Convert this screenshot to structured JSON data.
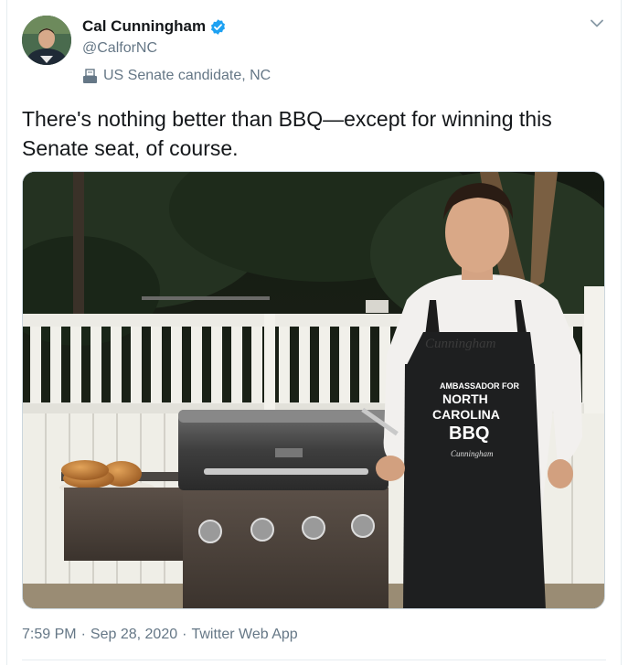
{
  "tweet": {
    "author": {
      "display_name": "Cal Cunningham",
      "handle": "@CalforNC",
      "verified": true,
      "label": "US Senate candidate, NC",
      "label_icon": "ballot-box-icon"
    },
    "text": "There's nothing better than BBQ—except for winning this Senate seat, of course.",
    "media": {
      "apron_lines": [
        "AMBASSADOR FOR",
        "NORTH",
        "CAROLINA",
        "BBQ"
      ],
      "shirt_text": "Cunningham"
    },
    "time": "7:59 PM",
    "date": "Sep 28, 2020",
    "source": "Twitter Web App",
    "separator": "·"
  },
  "colors": {
    "accent": "#1da1f2",
    "secondary_text": "#657786",
    "primary_text": "#14171a",
    "border": "#e6ecf0"
  },
  "icons": {
    "caret": "chevron-down-icon",
    "verified": "verified-badge-icon"
  }
}
